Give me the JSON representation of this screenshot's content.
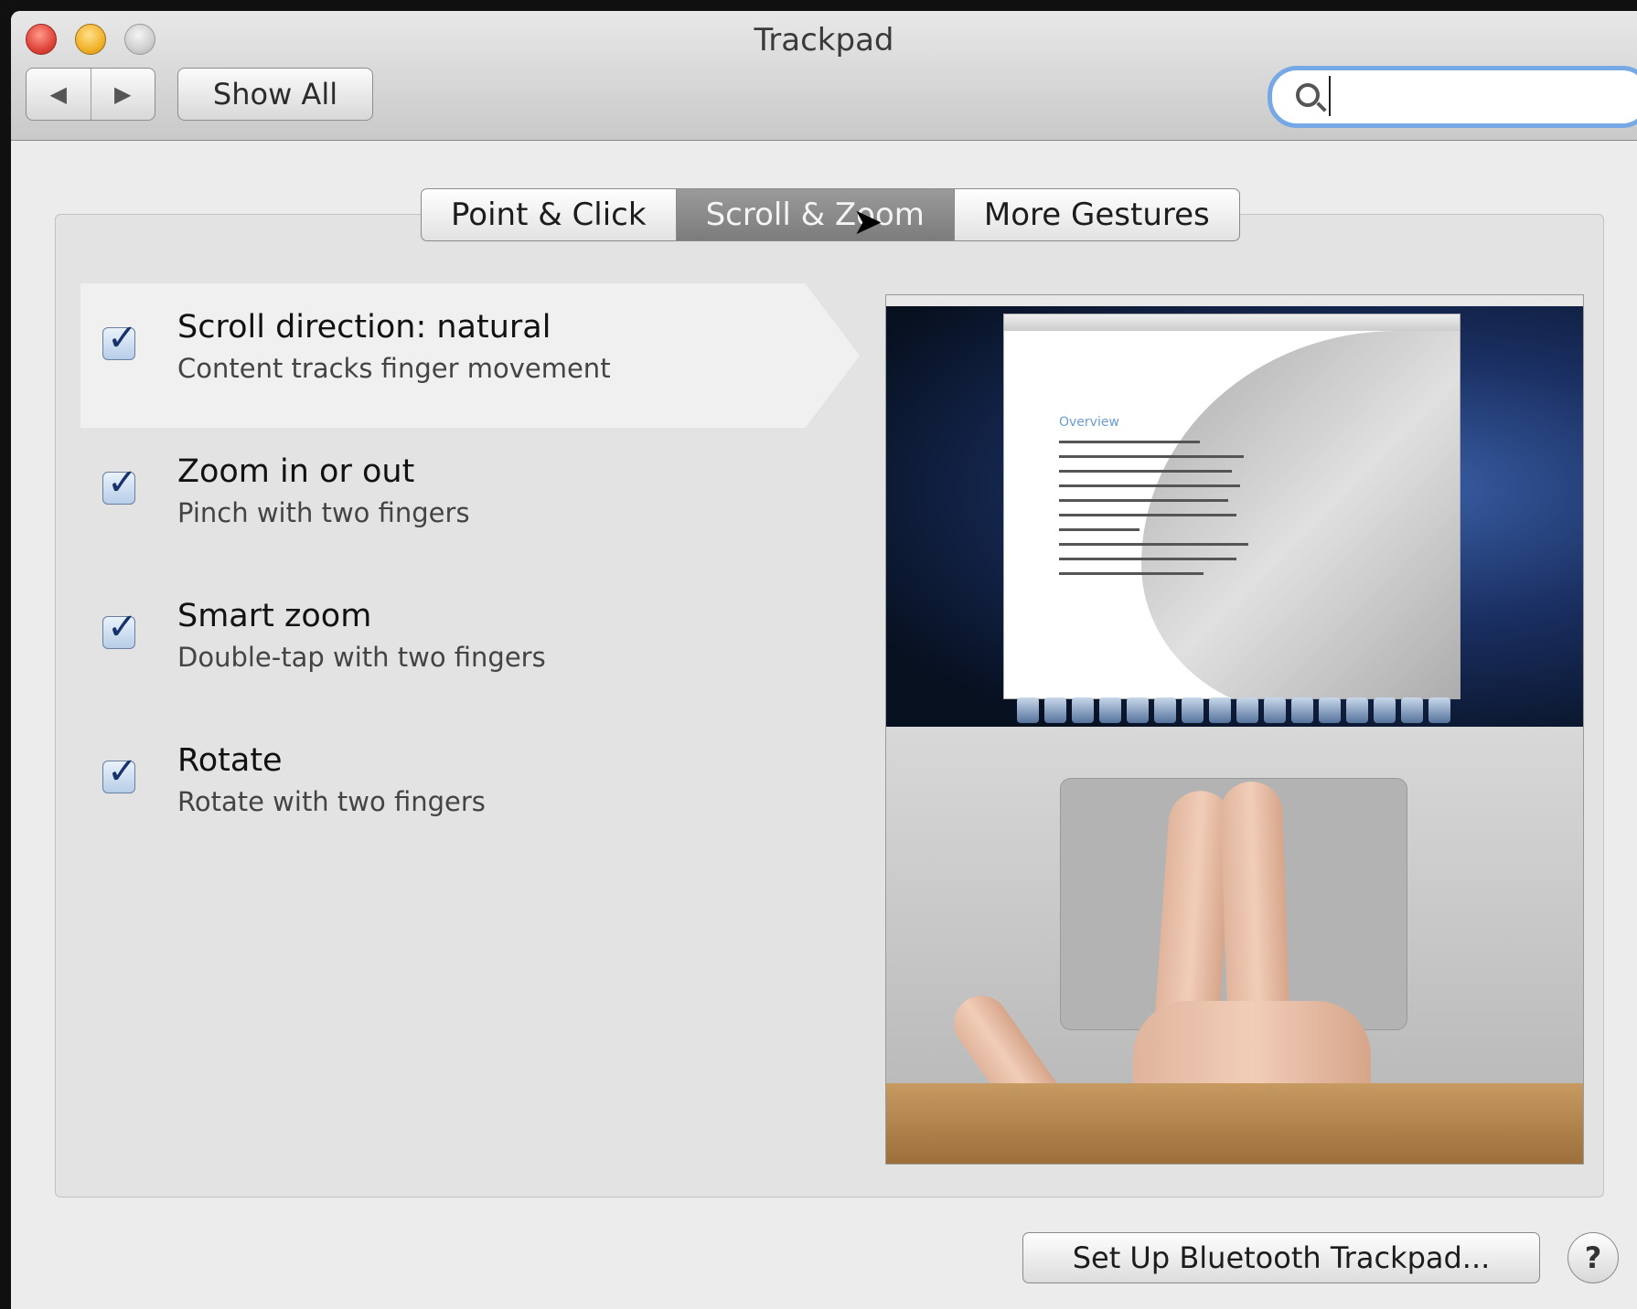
{
  "window": {
    "title": "Trackpad"
  },
  "toolbar": {
    "back_icon": "◀",
    "forward_icon": "▶",
    "show_all_label": "Show All",
    "search_placeholder": ""
  },
  "tabs": [
    {
      "label": "Point & Click",
      "active": false
    },
    {
      "label": "Scroll & Zoom",
      "active": true
    },
    {
      "label": "More Gestures",
      "active": false
    }
  ],
  "options": [
    {
      "title": "Scroll direction: natural",
      "subtitle": "Content tracks finger movement",
      "checked": true
    },
    {
      "title": "Zoom in or out",
      "subtitle": "Pinch with two fingers",
      "checked": true
    },
    {
      "title": "Smart zoom",
      "subtitle": "Double-tap with two fingers",
      "checked": true
    },
    {
      "title": "Rotate",
      "subtitle": "Rotate with two fingers",
      "checked": true
    }
  ],
  "preview": {
    "doc_heading": "Overview"
  },
  "footer": {
    "bluetooth_label": "Set Up Bluetooth Trackpad...",
    "help_label": "?"
  },
  "colors": {
    "accent": "#76a8e6",
    "active_tab": "#8a8a8a"
  }
}
